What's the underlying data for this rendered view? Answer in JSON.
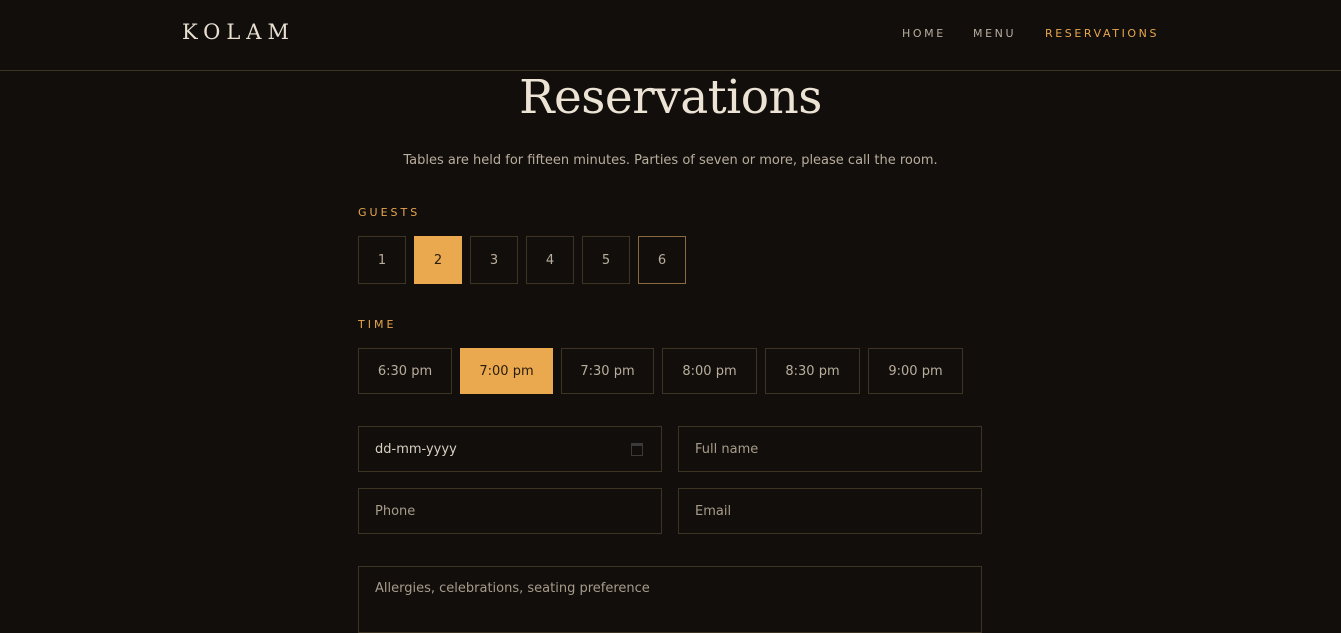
{
  "brand": "KOLAM",
  "nav": [
    {
      "label": "HOME",
      "active": false
    },
    {
      "label": "MENU",
      "active": false
    },
    {
      "label": "RESERVATIONS",
      "active": true
    }
  ],
  "page": {
    "title": "Reservations",
    "subtitle": "Tables are held for fifteen minutes. Parties of seven or more, please call the room."
  },
  "guests": {
    "label": "GUESTS",
    "options": [
      "1",
      "2",
      "3",
      "4",
      "5",
      "6"
    ],
    "selected": "2"
  },
  "time": {
    "label": "TIME",
    "options": [
      "6:30 pm",
      "7:00 pm",
      "7:30 pm",
      "8:00 pm",
      "8:30 pm",
      "9:00 pm"
    ],
    "selected": "7:00 pm"
  },
  "form": {
    "date_value": "dd-mm-yyyy",
    "name_placeholder": "Full name",
    "phone_placeholder": "Phone",
    "email_placeholder": "Email",
    "notes_placeholder": "Allergies, celebrations, seating preference"
  },
  "colors": {
    "background": "#110e0c",
    "accent": "#eaa84f",
    "border": "#3e3424"
  }
}
